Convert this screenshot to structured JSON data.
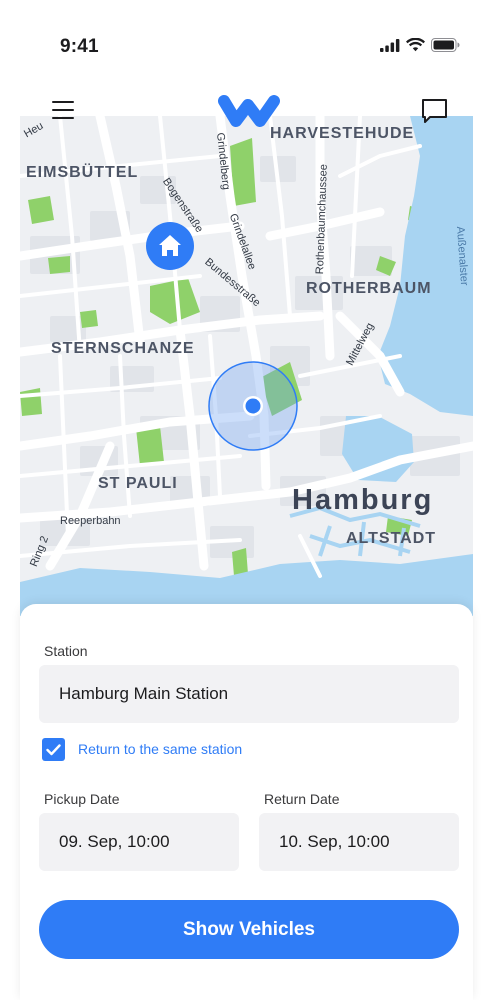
{
  "status_bar": {
    "time": "9:41"
  },
  "nav": {
    "menu_icon": "hamburger-menu-icon",
    "logo_icon": "brand-logo-w",
    "chat_icon": "chat-bubble-icon"
  },
  "map": {
    "districts": [
      "HARVESTEHUDE",
      "EIMSBÜTTEL",
      "ROTHERBAUM",
      "STERNSCHANZE",
      "ST PAULI",
      "ALTSTADT"
    ],
    "city": "Hamburg",
    "streets": [
      "Bogenstraße",
      "Grindelberg",
      "Grindelallee",
      "Bundesstraße",
      "Rothenbaumchaussee",
      "Mittelweg",
      "Reeperbahn",
      "Ring 2",
      "Außenalster",
      "Heu"
    ],
    "home_icon": "home-icon",
    "location_icon": "current-location-dot"
  },
  "form": {
    "station_label": "Station",
    "station_value": "Hamburg Main Station",
    "return_same_label": "Return to the same station",
    "return_same_checked": true,
    "pickup_label": "Pickup Date",
    "pickup_value": "09. Sep, 10:00",
    "return_label": "Return Date",
    "return_value": "10. Sep, 10:00",
    "submit_label": "Show Vehicles"
  },
  "colors": {
    "accent": "#2f7cf6",
    "water": "#a8d4f2",
    "park": "#8fd16a",
    "field_bg": "#f2f2f4"
  }
}
